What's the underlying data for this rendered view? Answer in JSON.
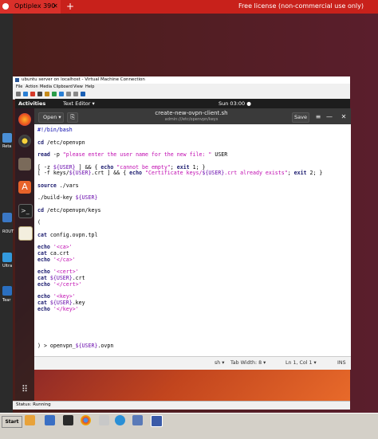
{
  "remote": {
    "tab_title": "Optiplex 390",
    "tab_close": "✕",
    "new_tab": "+",
    "license": "Free license (non-commercial use only)"
  },
  "desktop": {
    "labels": [
      "Reta",
      "ROUT",
      "Ultra",
      "Tear"
    ]
  },
  "vm_window": {
    "title": "ubuntu server on localhost - Virtual Machine Connection",
    "menu": [
      "File",
      "Action",
      "Media",
      "Clipboard",
      "View",
      "Help"
    ],
    "status": "Status: Running"
  },
  "ubuntu": {
    "activities": "Activities",
    "app_menu": "Text Editor ▾",
    "clock": "Sun 03:00 ●"
  },
  "gedit": {
    "open_label": "Open ▾",
    "doc_title": "create-new-ovpn-client.sh",
    "doc_path": "admin:///etc/openvpn/keys",
    "save_label": "Save",
    "menu_icon": "≡",
    "minimize_icon": "—",
    "close_icon": "✕"
  },
  "code_lines": [
    "#!/bin/bash",
    "",
    "cd /etc/openvpn",
    "",
    "read -p \"please enter the user name for the new file: \" USER",
    "",
    "[ -z ${USER} ] && { echo \"cannot be empty\"; exit 1; }",
    "[ -f keys/${USER}.crt ] && { echo \"Certificate keys/${USER}.crt already exists\"; exit 2; }",
    "",
    "source ./vars",
    "",
    "./build-key ${USER}",
    "",
    "cd /etc/openvpn/keys",
    "",
    "(",
    "",
    "cat config.ovpn.tpl",
    "",
    "echo '<ca>'",
    "cat ca.crt",
    "echo '</ca>'",
    "",
    "echo '<cert>'",
    "cat ${USER}.crt",
    "echo '</cert>'",
    "",
    "echo '<key>'",
    "cat ${USER}.key",
    "echo '</key>'",
    "",
    "",
    "",
    "",
    "",
    ") > openvpn_${USER}.ovpn"
  ],
  "status_bar": {
    "language": "sh ▾",
    "tab_width": "Tab Width: 8 ▾",
    "position": "Ln 1, Col 1 ▾",
    "mode": "INS"
  },
  "taskbar": {
    "start": "Start"
  },
  "icons": {
    "firefox": "firefox-icon",
    "rhythmbox": "rhythmbox-icon",
    "files": "files-icon",
    "software": "software-center-icon",
    "terminal": "terminal-icon",
    "editor": "text-editor-icon",
    "app_grid": "app-grid-icon"
  },
  "colors": {
    "accent": "#c8211b",
    "ubuntu_orange": "#e86a2a"
  }
}
